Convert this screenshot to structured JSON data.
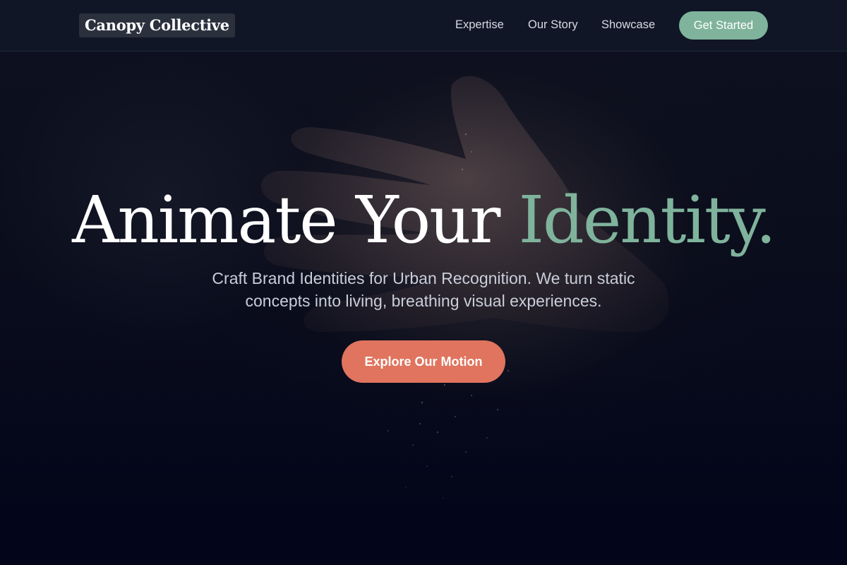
{
  "colors": {
    "accent_green": "#7fb39c",
    "accent_coral": "#e0745e",
    "background": "#030616",
    "nav_background": "#111626"
  },
  "nav": {
    "brand": "Canopy Collective",
    "links": [
      "Expertise",
      "Our Story",
      "Showcase"
    ],
    "cta": "Get Started"
  },
  "hero": {
    "title_main": "Animate Your",
    "title_accent": "Identity.",
    "subtitle": "Craft Brand Identities for Urban Recognition. We turn static concepts into living, breathing visual experiences.",
    "cta": "Explore Our Motion",
    "background_image": "dark-hand-with-falling-particles"
  }
}
